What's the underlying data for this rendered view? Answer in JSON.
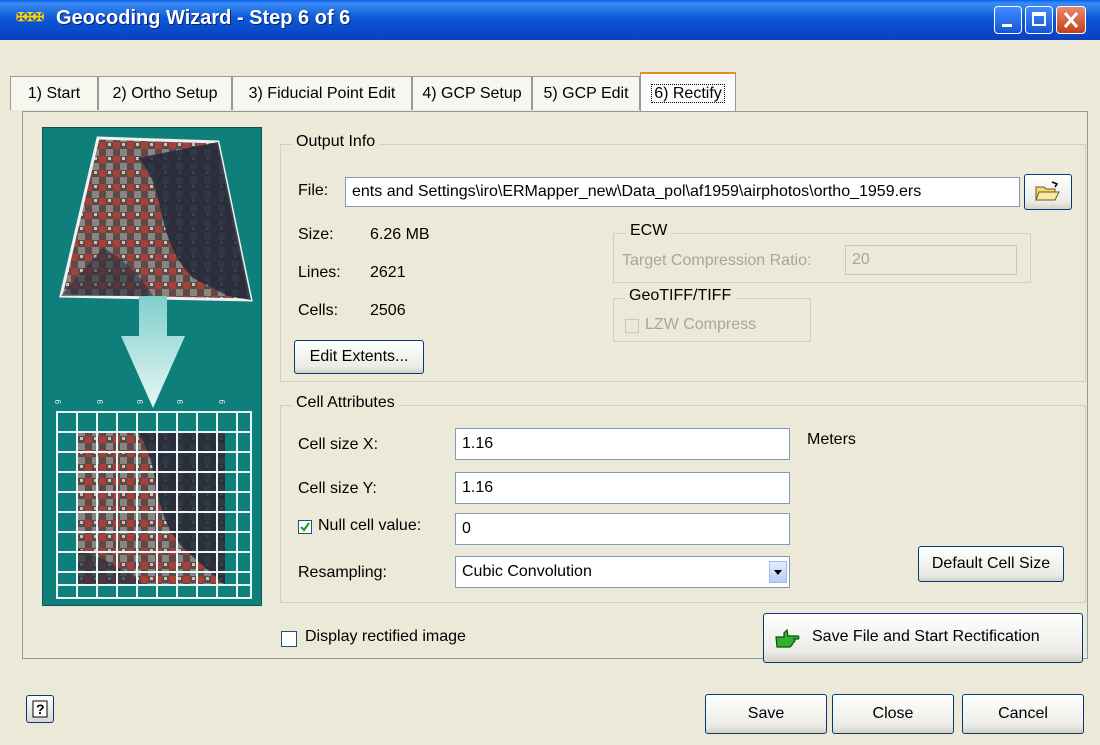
{
  "window": {
    "title": "Geocoding Wizard - Step 6 of 6",
    "icon": "app-icon"
  },
  "tabs": [
    {
      "label": "1) Start"
    },
    {
      "label": "2) Ortho Setup"
    },
    {
      "label": "3) Fiducial Point Edit"
    },
    {
      "label": "4) GCP Setup"
    },
    {
      "label": "5) GCP Edit"
    },
    {
      "label": "6) Rectify",
      "active": true
    }
  ],
  "output_info": {
    "title": "Output Info",
    "file_label": "File:",
    "file_value": "ents and Settings\\iro\\ERMapper_new\\Data_pol\\af1959\\airphotos\\ortho_1959.ers",
    "size_label": "Size:",
    "size_value": "6.26  MB",
    "lines_label": "Lines:",
    "lines_value": "2621",
    "cells_label": "Cells:",
    "cells_value": "2506",
    "edit_extents_label": "Edit Extents...",
    "ecw": {
      "title": "ECW",
      "ratio_label": "Target Compression Ratio:",
      "ratio_value": "20"
    },
    "geotiff": {
      "title": "GeoTIFF/TIFF",
      "lzw_label": "LZW Compress"
    }
  },
  "cell_attributes": {
    "title": "Cell Attributes",
    "cell_x_label": "Cell size X:",
    "cell_x_value": "1.16",
    "units": "Meters",
    "cell_y_label": "Cell size Y:",
    "cell_y_value": "1.16",
    "null_label": "Null cell value:",
    "null_value": "0",
    "resampling_label": "Resampling:",
    "resampling_value": "Cubic Convolution",
    "default_cell_size_label": "Default Cell Size"
  },
  "display_rectified_label": "Display rectified image",
  "save_start_label": "Save File and Start Rectification",
  "footer": {
    "save_label": "Save",
    "close_label": "Close",
    "cancel_label": "Cancel"
  },
  "colors": {
    "titlebar": "#0A4FD0",
    "thumbnail_bg": "#0E7F7A",
    "dialog_bg": "#ECE9D8"
  }
}
